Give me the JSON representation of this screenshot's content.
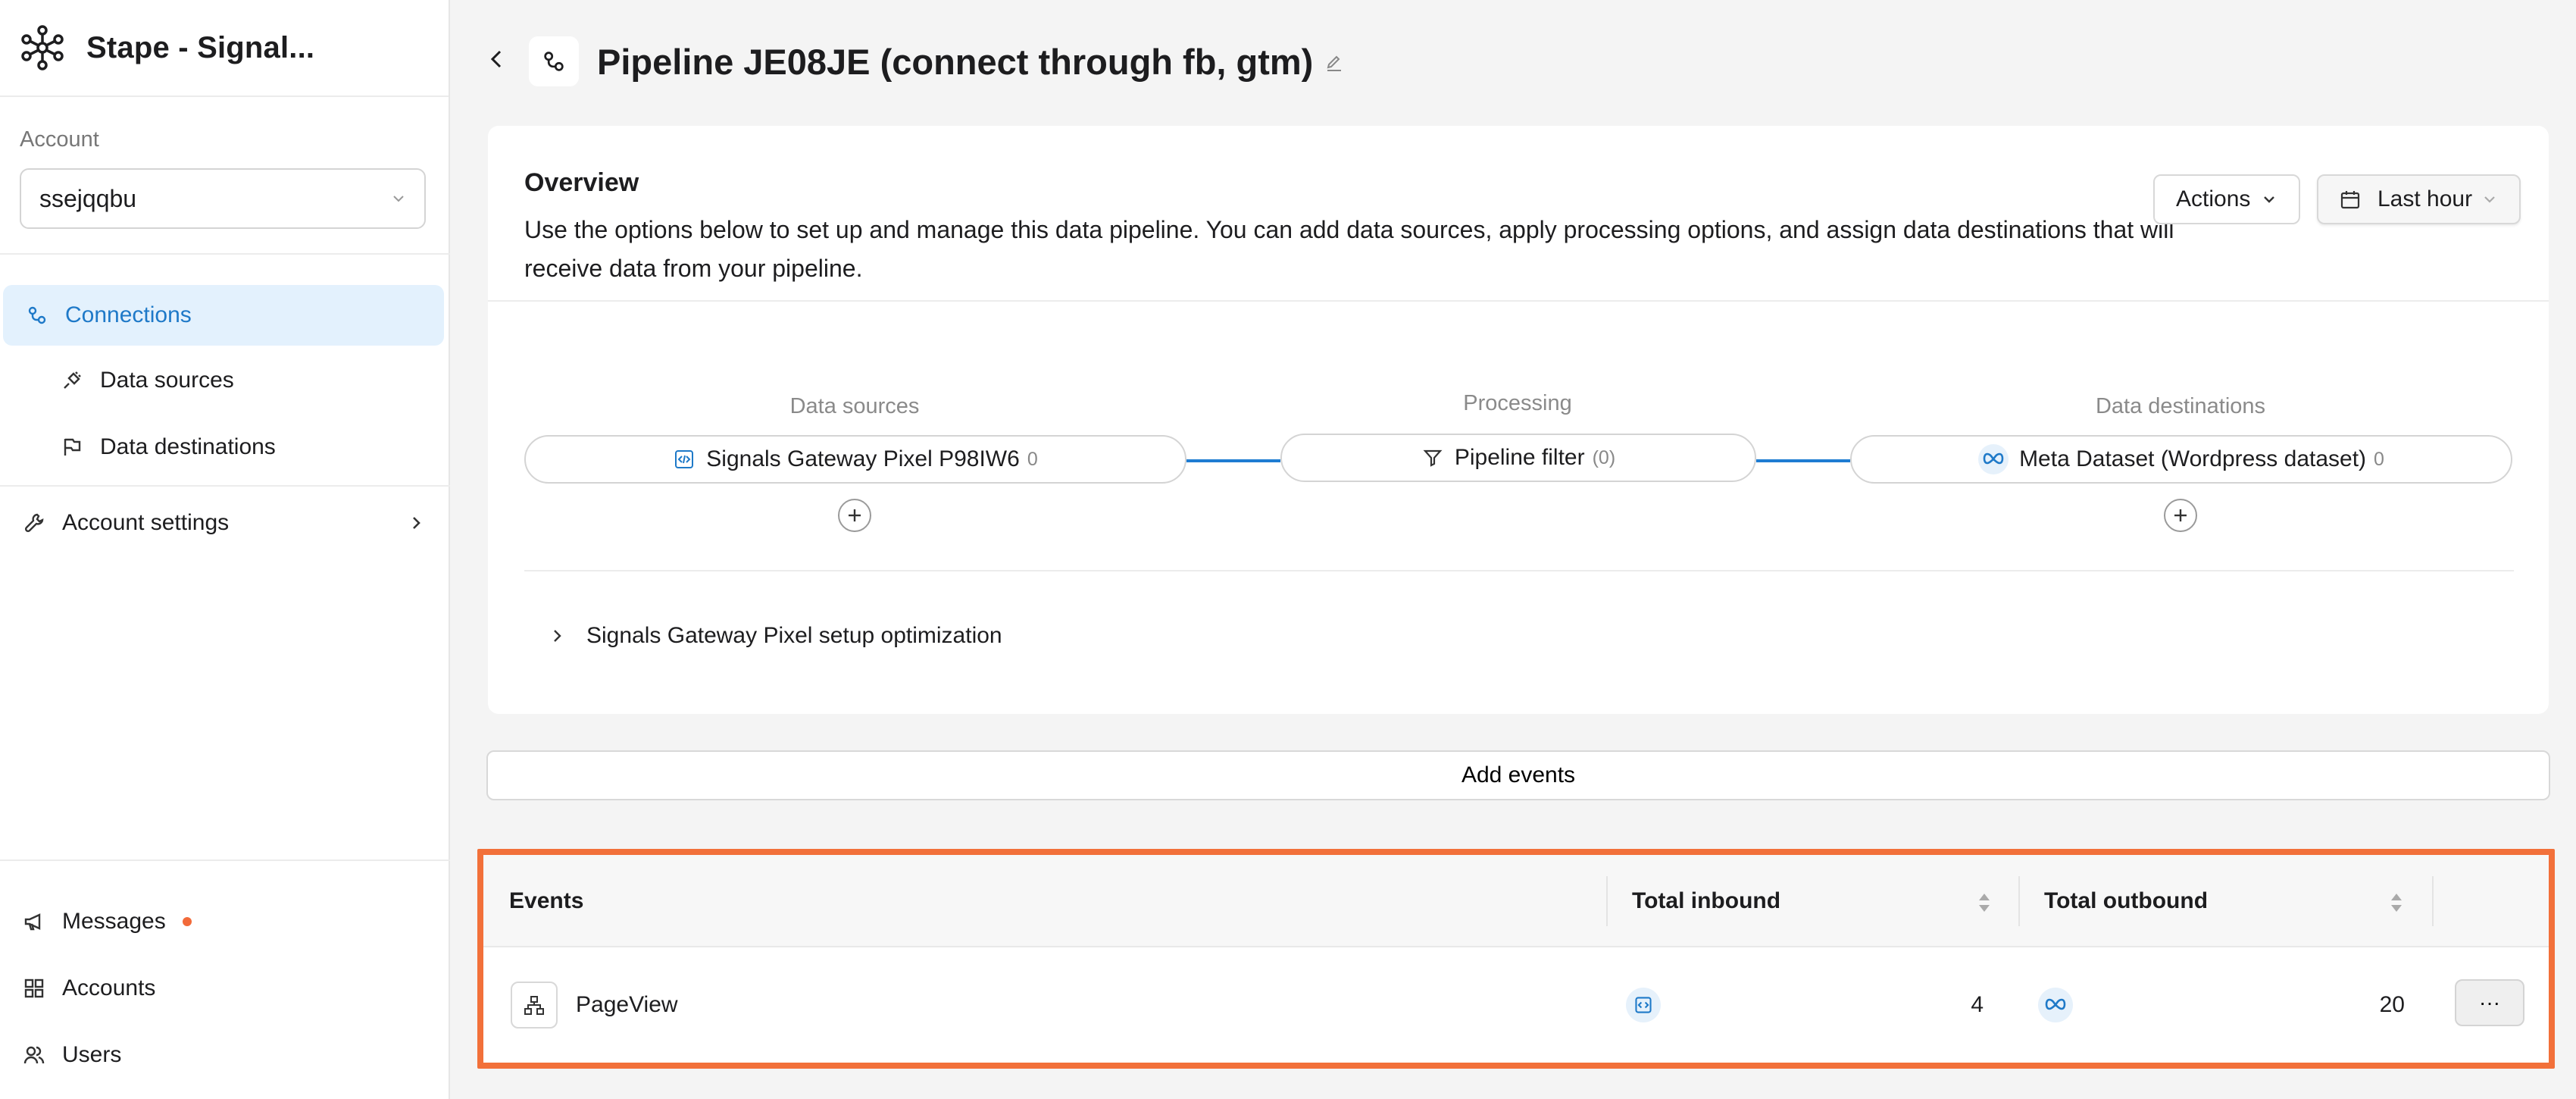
{
  "app": {
    "title": "Stape - Signal..."
  },
  "sidebar": {
    "account_label": "Account",
    "account_value": "ssejqqbu",
    "nav": {
      "connections": "Connections",
      "data_sources": "Data sources",
      "data_destinations": "Data destinations",
      "account_settings": "Account settings"
    },
    "bottom": {
      "messages": "Messages",
      "accounts": "Accounts",
      "users": "Users"
    }
  },
  "header": {
    "title": "Pipeline JE08JE (connect through fb, gtm)"
  },
  "overview": {
    "title": "Overview",
    "description": "Use the options below to set up and manage this data pipeline. You can add data sources, apply processing options, and assign data destinations that will receive data from your pipeline.",
    "actions_label": "Actions",
    "time_range_label": "Last hour",
    "pipeline": {
      "sources_label": "Data sources",
      "processing_label": "Processing",
      "destinations_label": "Data destinations",
      "source_name": "Signals Gateway Pixel P98IW6",
      "source_count": "0",
      "processing_name": "Pipeline filter",
      "processing_count": "(0)",
      "destination_name": "Meta Dataset (Wordpress dataset)",
      "destination_count": "0"
    },
    "optimization_label": "Signals Gateway Pixel setup optimization"
  },
  "add_events_label": "Add events",
  "events_table": {
    "headers": {
      "events": "Events",
      "total_inbound": "Total inbound",
      "total_outbound": "Total outbound"
    },
    "rows": [
      {
        "event": "PageView",
        "inbound": "4",
        "outbound": "20"
      }
    ],
    "more_label": "···"
  },
  "colors": {
    "accent": "#1e79c8",
    "highlight_border": "#f2703a",
    "notification_dot": "#f26a3a"
  }
}
